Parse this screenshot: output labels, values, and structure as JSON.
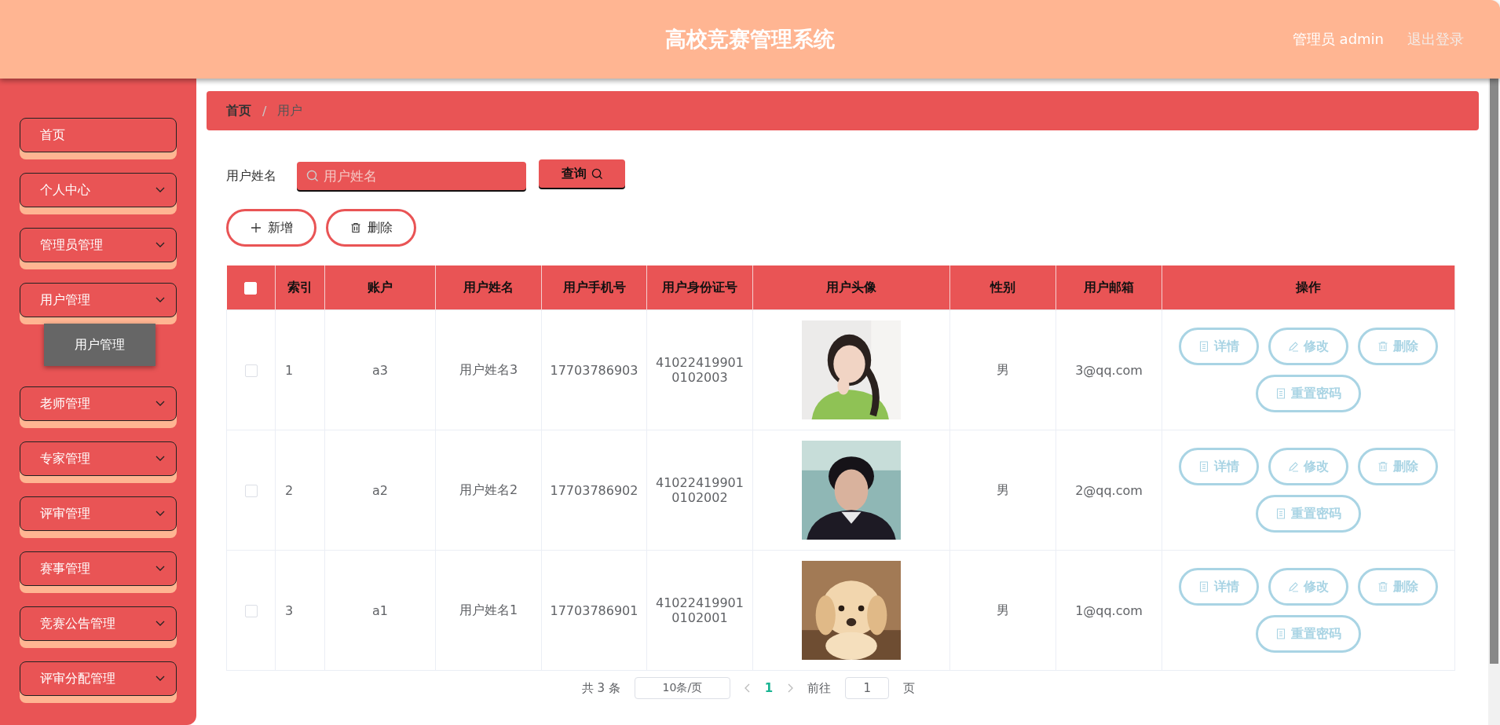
{
  "header": {
    "title": "高校竞赛管理系统",
    "user": "管理员 admin",
    "logout": "退出登录"
  },
  "sidebar": {
    "items": [
      {
        "label": "首页",
        "kind": "link"
      },
      {
        "label": "个人中心",
        "kind": "menu"
      },
      {
        "label": "管理员管理",
        "kind": "menu"
      },
      {
        "label": "用户管理",
        "kind": "menu",
        "children": [
          {
            "label": "用户管理"
          }
        ]
      },
      {
        "label": "老师管理",
        "kind": "menu"
      },
      {
        "label": "专家管理",
        "kind": "menu"
      },
      {
        "label": "评审管理",
        "kind": "menu"
      },
      {
        "label": "赛事管理",
        "kind": "menu"
      },
      {
        "label": "竞赛公告管理",
        "kind": "menu"
      },
      {
        "label": "评审分配管理",
        "kind": "menu"
      }
    ]
  },
  "breadcrumb": {
    "separator": "/",
    "items": [
      {
        "label": "首页"
      },
      {
        "label": "用户"
      }
    ]
  },
  "search": {
    "label": "用户姓名",
    "placeholder": "用户姓名",
    "button": "查询"
  },
  "toolbar": [
    {
      "kind": "add",
      "label": "新增"
    },
    {
      "kind": "delete",
      "label": "删除"
    }
  ],
  "table": {
    "select_all": {
      "checked": false
    },
    "columns": [
      "索引",
      "账户",
      "用户姓名",
      "用户手机号",
      "用户身份证号",
      "用户头像",
      "性别",
      "用户邮箱",
      "操作"
    ],
    "rows": [
      {
        "checked": false,
        "index": "1",
        "account": "a3",
        "name": "用户姓名3",
        "phone": "17703786903",
        "id_number": [
          "41022419901",
          "0102003"
        ],
        "avatar": {
          "kind": "picture"
        },
        "gender": "男",
        "email": "3@qq.com",
        "actions": [
          {
            "kind": "detail",
            "label": "详情"
          },
          {
            "kind": "edit",
            "label": "修改"
          },
          {
            "kind": "delete",
            "label": "删除"
          },
          {
            "kind": "reset",
            "label": "重置密码"
          }
        ]
      },
      {
        "checked": false,
        "index": "2",
        "account": "a2",
        "name": "用户姓名2",
        "phone": "17703786902",
        "id_number": [
          "41022419901",
          "0102002"
        ],
        "avatar": {
          "kind": "picture"
        },
        "gender": "男",
        "email": "2@qq.com",
        "actions": [
          {
            "kind": "detail",
            "label": "详情"
          },
          {
            "kind": "edit",
            "label": "修改"
          },
          {
            "kind": "delete",
            "label": "删除"
          },
          {
            "kind": "reset",
            "label": "重置密码"
          }
        ]
      },
      {
        "checked": false,
        "index": "3",
        "account": "a1",
        "name": "用户姓名1",
        "phone": "17703786901",
        "id_number": [
          "41022419901",
          "0102001"
        ],
        "avatar": {
          "kind": "picture"
        },
        "gender": "男",
        "email": "1@qq.com",
        "actions": [
          {
            "kind": "detail",
            "label": "详情"
          },
          {
            "kind": "edit",
            "label": "修改"
          },
          {
            "kind": "delete",
            "label": "删除"
          },
          {
            "kind": "reset",
            "label": "重置密码"
          }
        ]
      }
    ]
  },
  "pagination": {
    "total": "共 3 条",
    "page_size": "10条/页",
    "current": "1",
    "goto_label": "前往",
    "goto_value": "1",
    "goto_suffix": "页"
  }
}
